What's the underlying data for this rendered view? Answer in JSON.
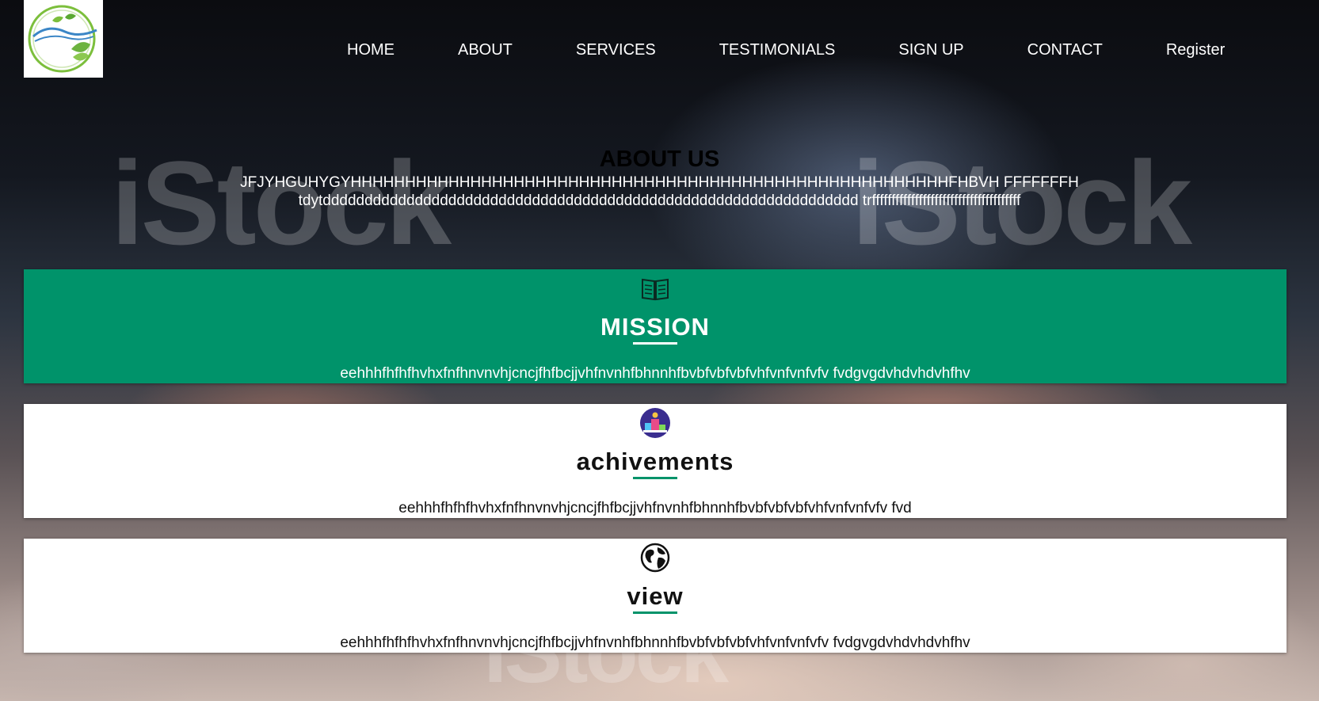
{
  "nav": {
    "items": [
      "HOME",
      "ABOUT",
      "SERVICES",
      "TESTIMONIALS",
      "SIGN UP",
      "CONTACT",
      "Register"
    ]
  },
  "about": {
    "title": "ABOUT US",
    "text": "JFJYHGUHYGYHHHHHHHHHHHHHHHHHHHHHHHHHHHHHHHHHHHHHHHHHHHHHHHHHHHHHHHFHBVH FFFFFFFH tdytdddddddddddddddddddddddddddddddddddddddddddddddddddddddddddddddd trffffffffffffffffffffffffffffffffffffff"
  },
  "cards": [
    {
      "icon": "book-icon",
      "title": "MISSION",
      "text": "eehhhfhfhfhvhxfnfhnvnvhjcncjfhfbcjjvhfnvnhfbhnnhfbvbfvbfvbfvhfvnfvnfvfv fvdgvgdvhdvhdvhfhv"
    },
    {
      "icon": "podium-icon",
      "title": "achivements",
      "text": "eehhhfhfhfhvhxfnfhnvnvhjcncjfhfbcjjvhfnvnhfbhnnhfbvbfvbfvbfvhfvnfvnfvfv fvd"
    },
    {
      "icon": "globe-icon",
      "title": "view",
      "text": "eehhhfhfhfhvhxfnfhnvnvhjcncjfhfbcjjvhfnvnhfbhnnhfbvbfvbfvbfvhfvnfvnfvfv fvdgvgdvhdvhdvhfhv"
    }
  ],
  "watermark": "iStock",
  "colors": {
    "accent": "#00936a",
    "nav_text": "#ffffff",
    "card_bg": "#ffffff"
  }
}
